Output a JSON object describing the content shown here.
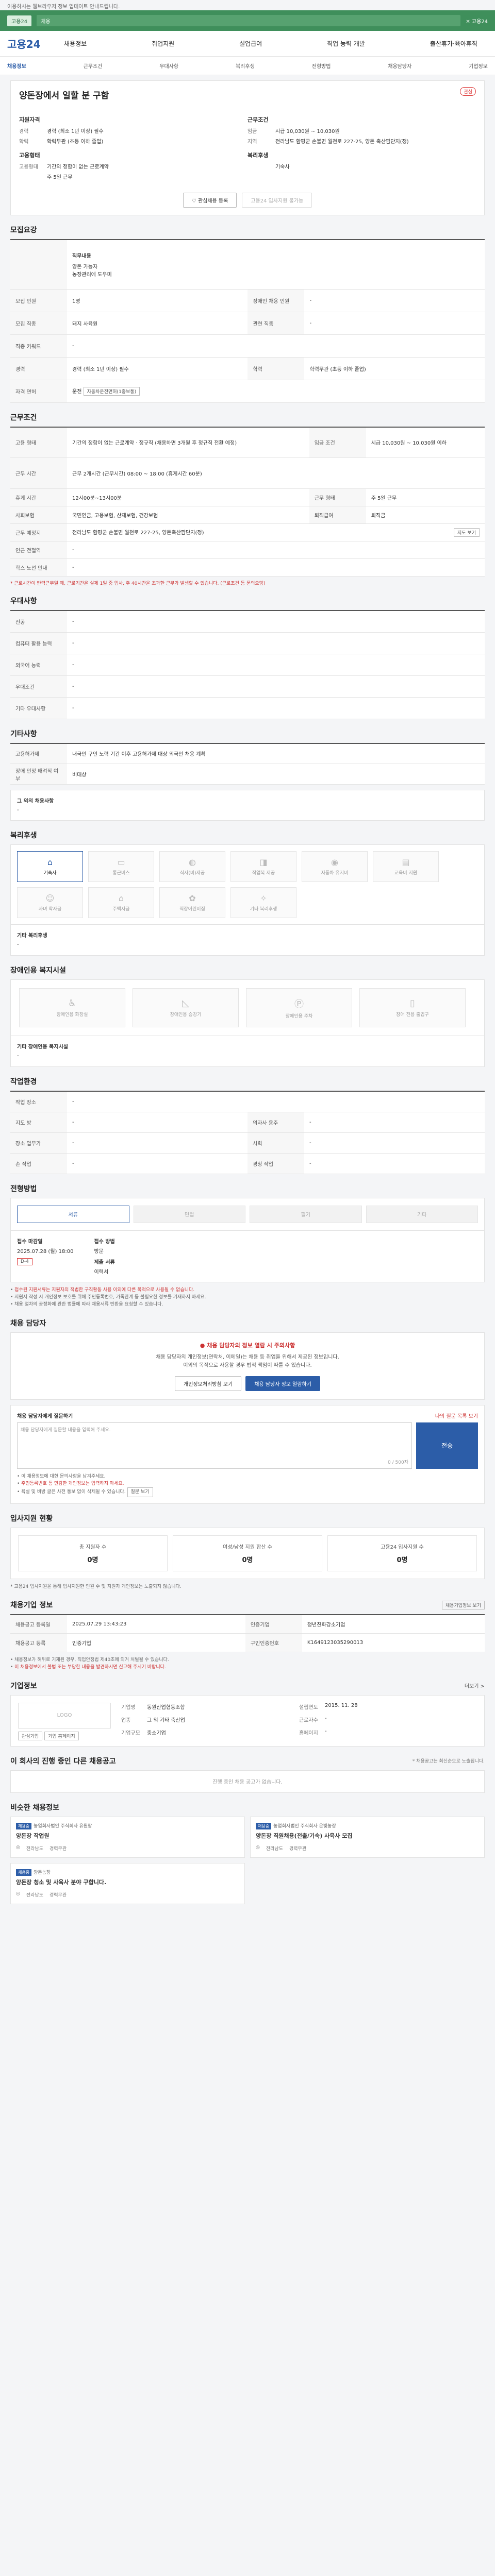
{
  "topbar": {
    "text": "이용하시는 웹브라우저 정보 업데이트 안내드립니다."
  },
  "promo": {
    "badge": "고용24",
    "input": "채용",
    "right": "✕ 고용24"
  },
  "header": {
    "logo": "고용24",
    "nav": [
      "채용정보",
      "취업지원",
      "실업급여",
      "직업 능력 개발",
      "출산휴가·육아휴직"
    ]
  },
  "subnav": [
    "채용정보",
    "근무조건",
    "우대사항",
    "복리후생",
    "전형방법",
    "채용담당자",
    "기업정보"
  ],
  "job": {
    "title": "양돈장에서 일할 분 구함",
    "scrap": "관심",
    "left_title": "지원자격",
    "left_rows": [
      {
        "k": "경력",
        "v": "경력 (최소 1년 이상) 필수"
      },
      {
        "k": "학력",
        "v": "학력무관 (초등 이하 졸업)"
      }
    ],
    "left_title2": "고용형태",
    "left_rows2": [
      {
        "k": "고용형태",
        "v": "기간의 정함이 없는 근로계약"
      },
      {
        "k": "",
        "v": "주 5일 근무"
      }
    ],
    "right_title": "근무조건",
    "right_rows": [
      {
        "k": "임금",
        "v": "시급 10,030원 ~ 10,030원"
      },
      {
        "k": "지역",
        "v": "전라남도 함평군 손불면 월천로 227-25, 양돈 축산팜단지(정)"
      }
    ],
    "right_title2": "복리후생",
    "right_rows2": [
      {
        "k": "",
        "v": "기숙사"
      }
    ],
    "btn_apply": "관심채용 등록",
    "btn_other": "고용24 입사지원 불가능"
  },
  "recruit": {
    "title": "모집요강",
    "field_title": "직무내용",
    "field_desc1": "양돈 가능자",
    "field_desc2": "농장관리에 도우미",
    "rows": [
      {
        "k": "모집 인원",
        "v": "1명",
        "k2": "장애인 채용 인원",
        "v2": "-"
      },
      {
        "k": "모집 직종",
        "v": "돼지 사육원",
        "k2": "관련 직종",
        "v2": "-"
      },
      {
        "k": "직종 키워드",
        "v": "-",
        "k2": "",
        "v2": ""
      },
      {
        "k": "경력",
        "v": "경력 (최소 1년 이상) 필수",
        "k2": "학력",
        "v2": "학력무관 (초등 이하 졸업)"
      },
      {
        "k": "자격 면허",
        "v": "운전",
        "k2": "",
        "v2": ""
      }
    ],
    "license_extra": "자동차운전면허(1종보통)"
  },
  "work": {
    "title": "근무조건",
    "rows": [
      {
        "k": "고용 형태",
        "v": "기간의 정함이 없는 근로계약 · 정규직 (채용하면 3개월 후 정규직 전환 예정)",
        "k2": "임금 조건",
        "v2": "시급 10,030원 ~ 10,030원 이하"
      },
      {
        "k": "근무 시간",
        "v": "근무 2개시간 (근무시간) 08:00 ~ 18:00 (휴게시간 60분)",
        "k2": "",
        "v2": ""
      },
      {
        "k": "휴게 시간",
        "v": "12시00분~13시00분",
        "k2": "근무 형태",
        "v2": "주 5일 근무"
      },
      {
        "k": "사회보험",
        "v": "국민연금, 고용보험, 산재보험, 건강보험",
        "k2": "퇴직급여",
        "v2": "퇴직금"
      },
      {
        "k": "근무 예정지",
        "v": "전라남도 함평군 손불면 월천로 227-25, 양돈축산팜단지(정)",
        "k2": "",
        "v2": ""
      },
      {
        "k": "인근 전철역",
        "v": "-",
        "k2": "",
        "v2": ""
      },
      {
        "k": "학스 노선 안내",
        "v": "-",
        "k2": "",
        "v2": ""
      }
    ],
    "map_btn": "지도 보기",
    "note": "* 근로시간이 탄력근무일 때, 근로기간은 실제 1일 중 입사, 주 40시간을 초과한 근무가 발생할 수 있습니다. (근로조건 등 문의요망)"
  },
  "pref": {
    "title": "우대사항",
    "rows": [
      {
        "k": "전공",
        "v": "-"
      },
      {
        "k": "컴퓨터 활용 능력",
        "v": "-"
      },
      {
        "k": "외국어 능력",
        "v": "-"
      },
      {
        "k": "우대조건",
        "v": "-"
      },
      {
        "k": "기타 우대사항",
        "v": "-"
      }
    ]
  },
  "etc": {
    "title": "기타사항",
    "rows": [
      {
        "k": "고용허가제",
        "v": "내국인 구인 노력 기간 이후 고용허가제 대상 외국인 채용 계획"
      },
      {
        "k": "장애 인정 배려직 여부",
        "v": "비대상"
      }
    ],
    "sub_title": "그 외의 채용사항",
    "sub_val": "-"
  },
  "welfare": {
    "title": "복리후생",
    "tiles": [
      {
        "icon": "bed-icon",
        "glyph": "⌂",
        "label": "기숙사",
        "on": true
      },
      {
        "icon": "bus-icon",
        "glyph": "▭",
        "label": "통근버스",
        "on": false
      },
      {
        "icon": "meal-icon",
        "glyph": "◍",
        "label": "식사(비)제공",
        "on": false
      },
      {
        "icon": "uniform-icon",
        "glyph": "◨",
        "label": "작업복 제공",
        "on": false
      },
      {
        "icon": "car-icon",
        "glyph": "◉",
        "label": "자동차 유지비",
        "on": false
      },
      {
        "icon": "edu-icon",
        "glyph": "▤",
        "label": "교육비 지원",
        "on": false
      },
      {
        "icon": "child-icon",
        "glyph": "☺",
        "label": "자녀 학자금",
        "on": false
      },
      {
        "icon": "house-icon",
        "glyph": "⌂",
        "label": "주택자금",
        "on": false
      },
      {
        "icon": "daycare-icon",
        "glyph": "✿",
        "label": "직장어린이집",
        "on": false
      },
      {
        "icon": "gift-icon",
        "glyph": "✧",
        "label": "기타 복리후생",
        "on": false
      }
    ],
    "sub_title": "기타 복리후생",
    "sub_val": "-"
  },
  "disability": {
    "title": "장애인용 복지시설",
    "tiles": [
      {
        "icon": "wheelchair-icon",
        "glyph": "♿",
        "label": "장애인용 화장실"
      },
      {
        "icon": "ramp-icon",
        "glyph": "◺",
        "label": "장애인용 승강기"
      },
      {
        "icon": "parking-icon",
        "glyph": "Ⓟ",
        "label": "장애인용 주차"
      },
      {
        "icon": "door-icon",
        "glyph": "▯",
        "label": "장애 전용 출입구"
      }
    ],
    "sub_title": "기타 장애인용 복지시설",
    "sub_val": "-"
  },
  "env": {
    "title": "작업환경",
    "rows": [
      {
        "k": "작업 장소",
        "v": "-",
        "k2": "",
        "v2": ""
      },
      {
        "k": "지도 방",
        "v": "-",
        "k2": "의자사 용주",
        "v2": "-"
      },
      {
        "k": "장소 업무가",
        "v": "-",
        "k2": "시력",
        "v2": "-"
      },
      {
        "k": "손 작업",
        "v": "-",
        "k2": "경청 작업",
        "v2": "-"
      }
    ]
  },
  "process": {
    "title": "전형방법",
    "steps": [
      "서류",
      "면접",
      "필기",
      "기타"
    ],
    "deadline_k": "접수 마감일",
    "deadline_v": "2025.07.28 (월) 18:00",
    "deadline_badge": "D-4",
    "method_k": "접수 방법",
    "method_v": "방문",
    "doc_k": "제출 서류",
    "doc_v": "이력서",
    "bullets": [
      "접수된 지원서류는 지원자의 적법한 구직활동 사용 이외에 다른 목적으로 사용될 수 없습니다.",
      "지원서 작성 시 개인정보 보호를 위해 주민등록번호, 가족관계 등 불필요한 정보를 기재하지 마세요.",
      "채용 절차의 공정화에 관한 법률에 따라 채용서류 반환을 요청할 수 있습니다."
    ]
  },
  "contact": {
    "title": "채용 담당자",
    "warn_title": "채용 담당자의 정보 열람 시 주의사항",
    "warn_desc1": "채용 담당자의 개인정보(연락처, 이메일)는 채용 등 취업을 위해서 제공된 정보입니다.",
    "warn_desc2": "이외의 목적으로 사용할 경우 법적 책임이 따를 수 있습니다.",
    "btn_private": "개인정보처리방침 보기",
    "btn_show": "채용 담당자 정보 열람하기",
    "q_title": "채용 담당자에게 질문하기",
    "q_link": "나의 질문 목록 보기",
    "q_placeholder": "채용 담당자에게 질문할 내용을 입력해 주세요.",
    "q_count": "0 / 500자",
    "q_send": "전송",
    "q_bullets": [
      "이 채용정보에 대한 문의사항을 남겨주세요.",
      "주민등록번호 등 민감한 개인정보는 입력하지 마세요.",
      "욕설 및 비방 글은 사전 통보 없이 삭제될 수 있습니다."
    ],
    "q_extra_btn": "질문 보기"
  },
  "apply": {
    "title": "입사지원 현황",
    "stats": [
      {
        "k": "총 지원자 수",
        "v": "0명"
      },
      {
        "k": "여성/남성 지원 합산 수",
        "v": "0명"
      },
      {
        "k": "고용24 입사지원 수",
        "v": "0명"
      }
    ],
    "note": "* 고용24 입사지원을 통해 입사지원한 인원 수 및 지원자 개인정보는 노출되지 않습니다."
  },
  "info": {
    "title": "채용기업 정보",
    "link": "채용기업정보 보기",
    "rows": [
      {
        "k": "채용공고 등록일",
        "v": "2025.07.29 13:43:23",
        "k2": "인증기업",
        "v2": "청년친화강소기업"
      },
      {
        "k": "채용공고 등록",
        "v": "인증기업",
        "k2": "구인인증번호",
        "v2": "K1649123035290013"
      }
    ],
    "bullets": [
      "채용정보가 허위로 기재된 경우, 직업안정법 제40조에 의거 처벌될 수 있습니다.",
      "이 채용정보에서 불법 또는 부당한 내용을 발견하시면 신고해 주시기 바랍니다."
    ]
  },
  "company": {
    "title": "기업정보",
    "more": "더보기 >",
    "logo": "LOGO",
    "btn1": "관심기업",
    "btn2": "기업 홈페이지",
    "rows": [
      {
        "k": "기업명",
        "v": "동원산업협동조합",
        "k2": "설립연도",
        "v2": "2015. 11. 28"
      },
      {
        "k": "업종",
        "v": "그 외 기타 축산업",
        "k2": "근로자수",
        "v2": "-"
      },
      {
        "k": "기업규모",
        "v": "중소기업",
        "k2": "홈페이지",
        "v2": "-"
      }
    ]
  },
  "others": {
    "title": "이 회사의 진행 중인 다른 채용공고",
    "note": "* 채용공고는 최신순으로 노출됩니다.",
    "empty": "진행 중인 채용 공고가 없습니다."
  },
  "reco": {
    "title": "비슷한 채용정보",
    "cards": [
      {
        "badge": "채용중",
        "company": "농업회사법인 주식회사 유원팜",
        "title": "양돈장 작업원",
        "m1": "전라남도",
        "m2": "경력무관"
      },
      {
        "badge": "채용중",
        "company": "농업회사법인 주식회사 은빛농장",
        "title": "양돈장 직원채용(전출/기숙) 사육사 모집",
        "m1": "전라남도",
        "m2": "경력무관"
      },
      {
        "badge": "채용중",
        "company": "양돈농장",
        "title": "양돈장 청소 및 사육사 분야 구합니다.",
        "m1": "전라남도",
        "m2": "경력무관"
      }
    ]
  }
}
